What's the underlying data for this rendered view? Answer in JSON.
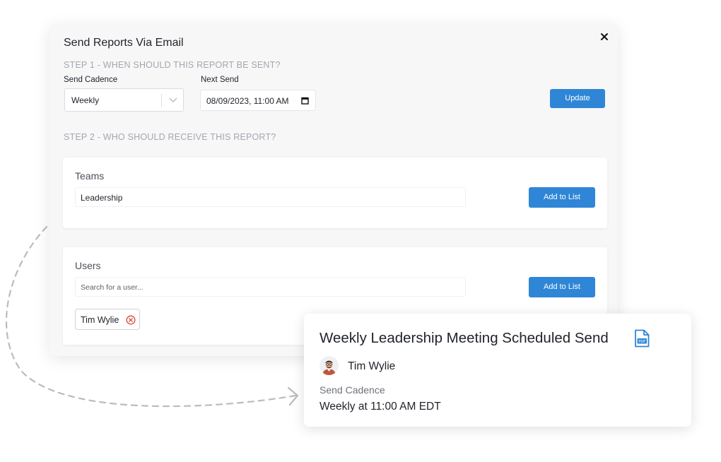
{
  "modal": {
    "title": "Send Reports Via Email",
    "step1": "STEP 1 - WHEN SHOULD THIS REPORT BE SENT?",
    "send_cadence_label": "Send Cadence",
    "send_cadence_value": "Weekly",
    "next_send_label": "Next Send",
    "next_send_value": "08/09/2023, 11:00 AM",
    "update_label": "Update",
    "step2": "STEP 2 - WHO SHOULD RECEIVE THIS REPORT?",
    "teams": {
      "title": "Teams",
      "input_value": "Leadership",
      "add_label": "Add to List"
    },
    "users": {
      "title": "Users",
      "placeholder": "Search for a user...",
      "add_label": "Add to List",
      "chips": [
        "Tim Wylie"
      ]
    }
  },
  "summary": {
    "title": "Weekly Leadership Meeting Scheduled Send",
    "user": "Tim Wylie",
    "cadence_label": "Send Cadence",
    "cadence_value": "Weekly at 11:00 AM EDT"
  },
  "colors": {
    "accent": "#2f86d6",
    "remove": "#e0443a"
  },
  "icons": [
    "close-icon",
    "chevron-down-icon",
    "calendar-icon",
    "remove-circle-icon",
    "pdf-file-icon",
    "avatar"
  ]
}
